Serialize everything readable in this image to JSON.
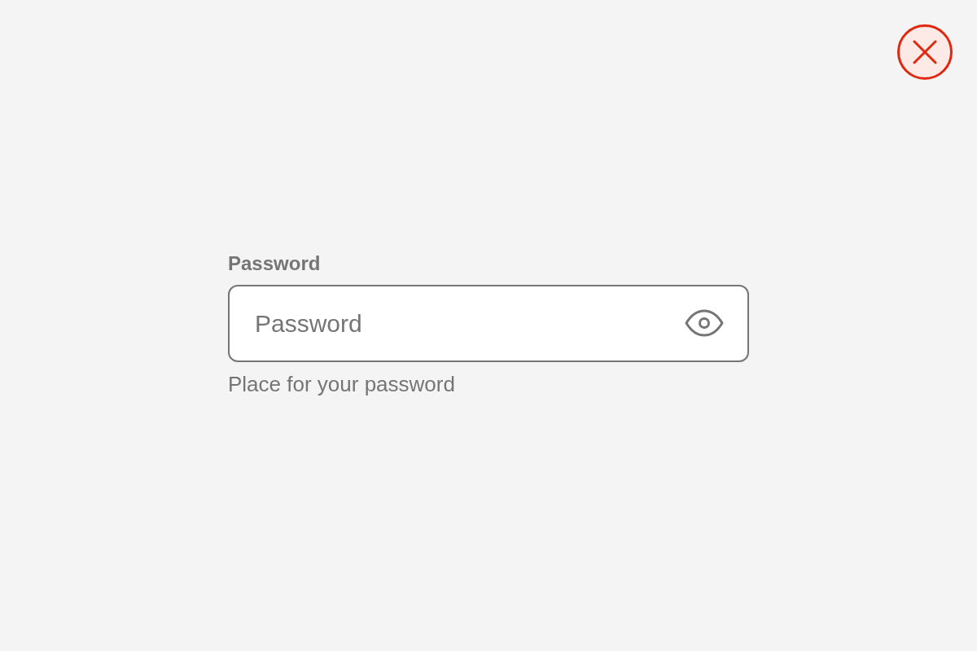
{
  "password_field": {
    "label": "Password",
    "placeholder": "Password",
    "helper": "Place for your password"
  }
}
